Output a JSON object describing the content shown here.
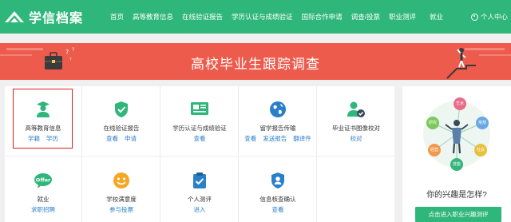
{
  "brand": {
    "name": "学信档案"
  },
  "nav": [
    "首页",
    "高等教育信息",
    "在线验证报告",
    "学历认证与成绩验证",
    "国际合作申请",
    "调查/投票",
    "职业测评",
    "就业"
  ],
  "user_menu": {
    "label": "个人中心"
  },
  "banner": {
    "title": "高校毕业生跟踪调查"
  },
  "services": [
    {
      "label": "高等教育信息",
      "links": [
        "学籍",
        "学历"
      ],
      "icon": "graduate-icon"
    },
    {
      "label": "在线验证报告",
      "links": [
        "查看",
        "申请"
      ],
      "icon": "shield-check-icon"
    },
    {
      "label": "学历认证与成绩验证",
      "links": [
        "查看"
      ],
      "icon": "certificate-icon"
    },
    {
      "label": "留学报告传输",
      "links": [
        "查看",
        "发送报告",
        "翻译件"
      ],
      "icon": "globe-icon"
    },
    {
      "label": "毕业证书图像校对",
      "links": [
        "校对"
      ],
      "icon": "user-check-icon"
    },
    {
      "label": "就业",
      "links": [
        "求职招聘"
      ],
      "icon": "offer-icon"
    },
    {
      "label": "学校满意度",
      "links": [
        "参与投票"
      ],
      "icon": "smile-icon"
    },
    {
      "label": "个人测评",
      "links": [
        "进入"
      ],
      "icon": "clipboard-check-icon"
    },
    {
      "label": "信息核查确认",
      "links": [
        "查看"
      ],
      "icon": "shield-user-icon"
    }
  ],
  "side": {
    "title": "你的兴趣是怎样?",
    "button": "点击进入职业兴趣测评",
    "bubbles": [
      "艺术",
      "研究",
      "常规",
      "经营",
      "社会",
      "技能"
    ]
  },
  "colors": {
    "brand_green": "#2fb67a",
    "banner_red": "#ec5b4b",
    "link_blue": "#2a7fc9",
    "highlight_red": "#e21d1d"
  }
}
